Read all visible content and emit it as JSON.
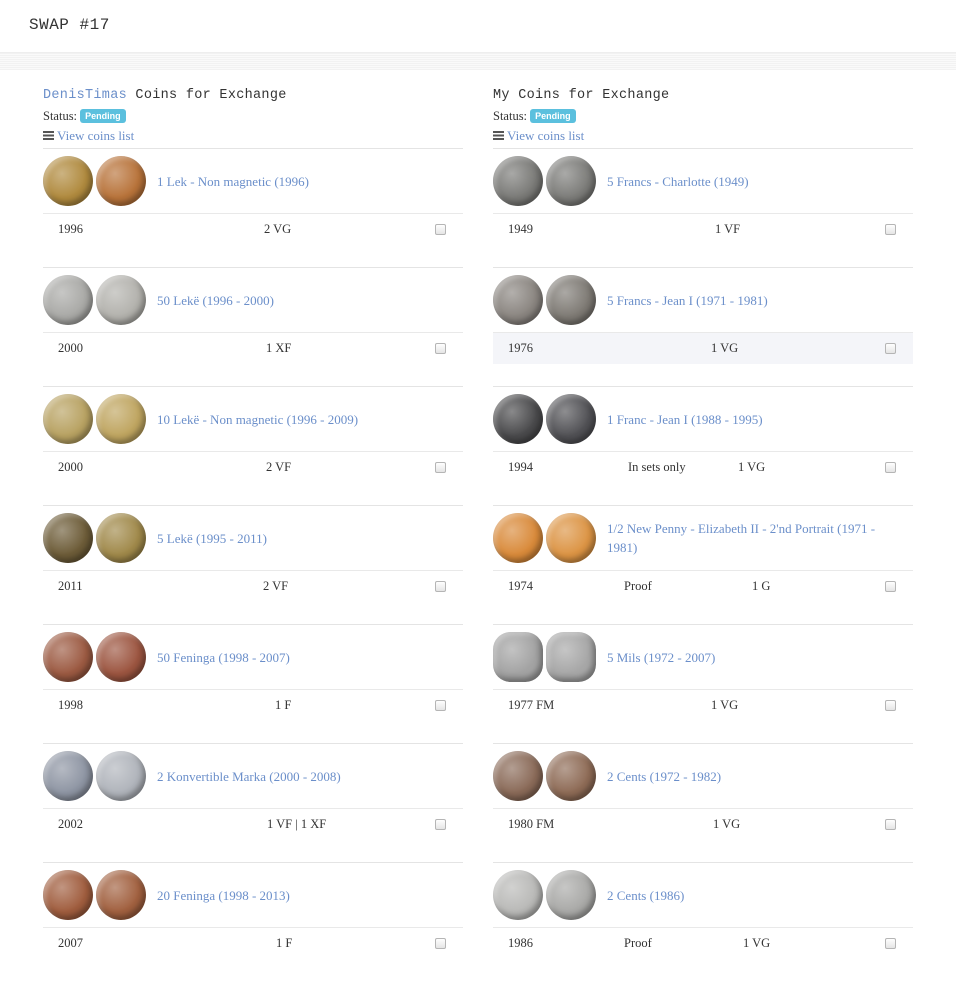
{
  "page_title": "SWAP #17",
  "left": {
    "title_user": "DenisTimas",
    "title_rest": " Coins for Exchange",
    "status_label": "Status:",
    "status_badge": "Pending",
    "view_link": "View coins list",
    "coins": [
      {
        "name": "1 Lek - Non magnetic (1996)",
        "year": "1996",
        "note": "",
        "grade": "2 VG",
        "colors": [
          "#b08a3e",
          "#b8733a"
        ]
      },
      {
        "name": "50 Lekë (1996 - 2000)",
        "year": "2000",
        "note": "",
        "grade": "1 XF",
        "colors": [
          "#a9a9a6",
          "#b3b2ad"
        ]
      },
      {
        "name": "10 Lekë - Non magnetic (1996 - 2009)",
        "year": "2000",
        "note": "",
        "grade": "2 VF",
        "colors": [
          "#b8a262",
          "#bfa560"
        ]
      },
      {
        "name": "5 Lekë (1995 - 2011)",
        "year": "2011",
        "note": "",
        "grade": "2 VF",
        "colors": [
          "#6d5c38",
          "#a0894a"
        ]
      },
      {
        "name": "50 Feninga (1998 - 2007)",
        "year": "1998",
        "note": "",
        "grade": "1 F",
        "colors": [
          "#9c5a42",
          "#9c5540"
        ]
      },
      {
        "name": "2 Konvertible Marka (2000 - 2008)",
        "year": "2002",
        "note": "",
        "grade": "1 VF | 1 XF",
        "colors": [
          "#8e95a3",
          "#b0b4bb"
        ]
      },
      {
        "name": "20 Feninga (1998 - 2013)",
        "year": "2007",
        "note": "",
        "grade": "1 F",
        "colors": [
          "#a05d3e",
          "#a1603f"
        ]
      }
    ]
  },
  "right": {
    "title": "My Coins for Exchange",
    "status_label": "Status:",
    "status_badge": "Pending",
    "view_link": "View coins list",
    "coins": [
      {
        "name": "5 Francs - Charlotte (1949)",
        "year": "1949",
        "note": "",
        "grade": "1 VF",
        "colors": [
          "#7a7a77",
          "#7c7c79"
        ]
      },
      {
        "name": "5 Francs - Jean I (1971 - 1981)",
        "year": "1976",
        "note": "",
        "grade": "1 VG",
        "colors": [
          "#8a8580",
          "#7e7a74"
        ]
      },
      {
        "name": "1 Franc - Jean I (1988 - 1995)",
        "year": "1994",
        "note": "In sets only",
        "grade": "1 VG",
        "colors": [
          "#4a4a4c",
          "#515155"
        ]
      },
      {
        "name": "1/2 New Penny - Elizabeth II - 2'nd Portrait (1971 - 1981)",
        "year": "1974",
        "note": "Proof",
        "grade": "1 G",
        "colors": [
          "#d98a3a",
          "#dc9444"
        ]
      },
      {
        "name": "5 Mils (1972 - 2007)",
        "year": "1977 FM",
        "note": "",
        "grade": "1 VG",
        "colors": [
          "#a3a3a3",
          "#a7a7a7"
        ]
      },
      {
        "name": "2 Cents (1972 - 1982)",
        "year": "1980 FM",
        "note": "",
        "grade": "1 VG",
        "colors": [
          "#8a6a58",
          "#8e6b56"
        ]
      },
      {
        "name": "2 Cents (1986)",
        "year": "1986",
        "note": "Proof",
        "grade": "1 VG",
        "colors": [
          "#b9b9b7",
          "#a9a9a7"
        ]
      }
    ]
  }
}
